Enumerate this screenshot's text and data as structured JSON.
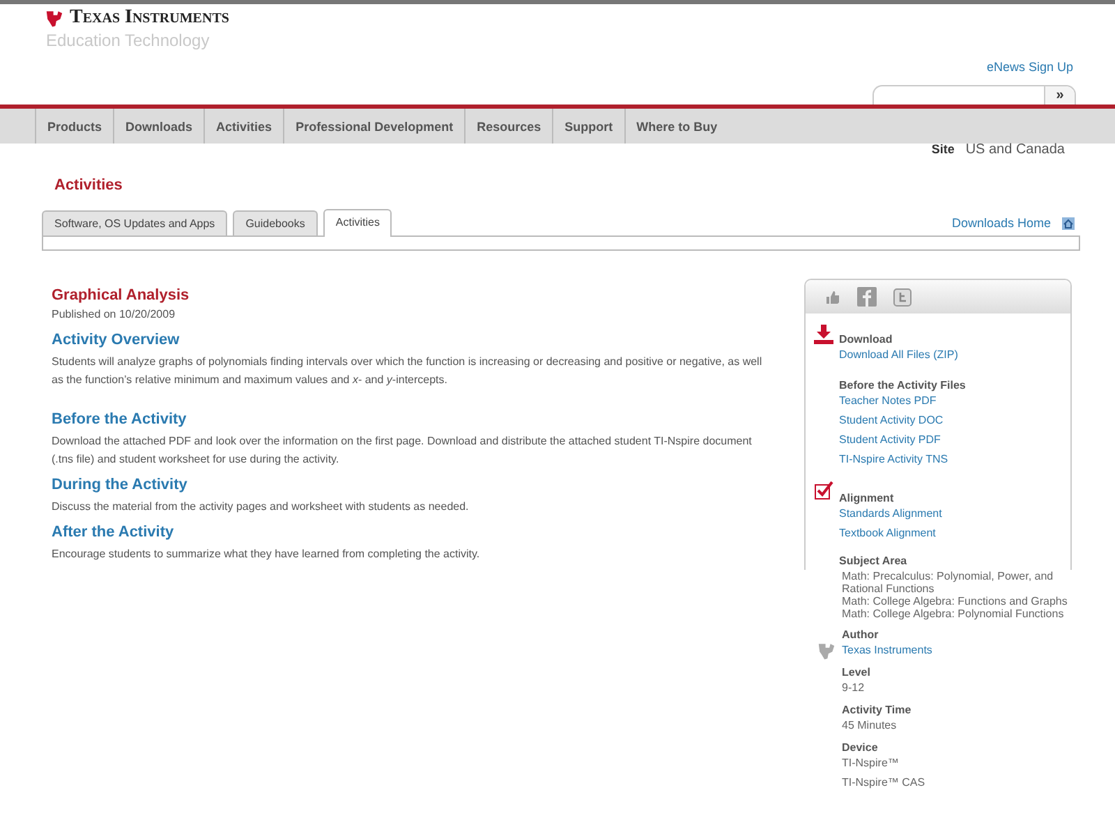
{
  "header": {
    "brand": "Texas Instruments",
    "subtitle": "Education Technology",
    "enews": "eNews Sign Up",
    "search_button": "»"
  },
  "nav": [
    "Products",
    "Downloads",
    "Activities",
    "Professional Development",
    "Resources",
    "Support",
    "Where to Buy"
  ],
  "site": {
    "label": "Site",
    "value": "US and Canada"
  },
  "page_title": "Activities",
  "tabs": [
    {
      "label": "Software, OS Updates and Apps",
      "selected": false
    },
    {
      "label": "Guidebooks",
      "selected": false
    },
    {
      "label": "Activities",
      "selected": true
    }
  ],
  "downloads_home": "Downloads Home",
  "article": {
    "title": "Graphical Analysis",
    "published": "Published on 10/20/2009",
    "sections": [
      {
        "heading": "Activity Overview",
        "text": "Students will analyze graphs of polynomials finding intervals over which the function is increasing or decreasing and positive or negative, as well as the function’s relative minimum and maximum values and *x*- and *y*-intercepts."
      },
      {
        "heading": "Before the Activity",
        "text": "Download the attached PDF and look over the information on the first page. Download and distribute the attached student TI-Nspire document (.tns file) and student worksheet for use during the activity."
      },
      {
        "heading": "During the Activity",
        "text": "Discuss the material from the activity pages and worksheet with students as needed."
      },
      {
        "heading": "After the Activity",
        "text": "Encourage students to summarize what they have learned from completing the activity."
      }
    ]
  },
  "sidebar": {
    "download": {
      "heading": "Download",
      "link": "Download All Files (ZIP)"
    },
    "files": {
      "heading": "Before the Activity Files",
      "links": [
        "Teacher Notes PDF",
        "Student Activity DOC",
        "Student Activity PDF",
        "TI-Nspire Activity TNS"
      ]
    },
    "alignment": {
      "heading": "Alignment",
      "links": [
        "Standards Alignment",
        "Textbook Alignment"
      ]
    },
    "subject_area": {
      "heading": "Subject Area",
      "lines": [
        "Math: Precalculus: Polynomial, Power, and Rational Functions",
        "Math: College Algebra: Functions and Graphs",
        "Math: College Algebra: Polynomial Functions"
      ]
    },
    "author": {
      "heading": "Author",
      "link": "Texas Instruments"
    },
    "details": [
      {
        "heading": "Level",
        "values": [
          "9-12"
        ]
      },
      {
        "heading": "Activity Time",
        "values": [
          "45 Minutes"
        ]
      },
      {
        "heading": "Device",
        "values": [
          "TI-Nspire™",
          "TI-Nspire™ CAS"
        ]
      }
    ]
  }
}
